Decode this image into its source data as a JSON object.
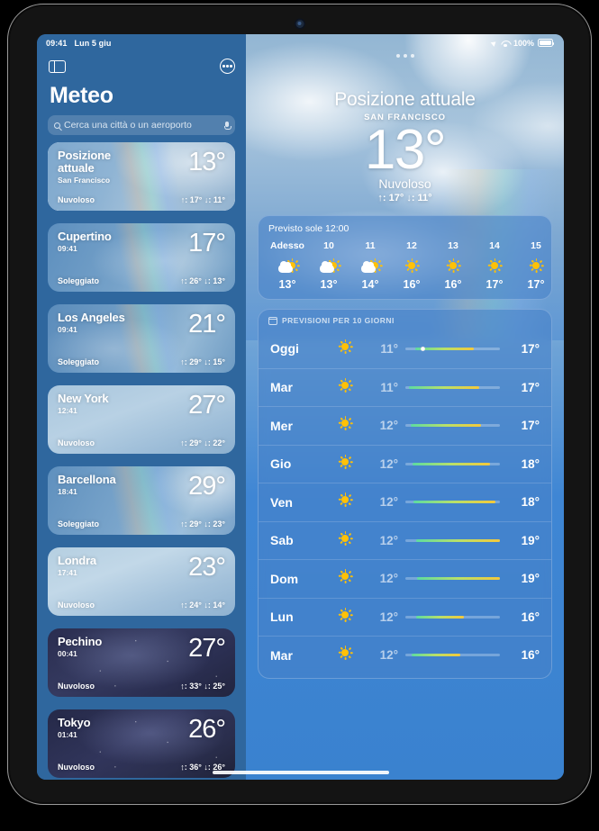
{
  "status_bar": {
    "time": "09:41",
    "date": "Lun 5 giu",
    "battery_percent": "100%",
    "location_icon": "location-arrow-icon",
    "wifi_icon": "wifi-icon",
    "battery_icon": "battery-icon"
  },
  "sidebar": {
    "toggle_icon": "sidebar-toggle-icon",
    "more_icon": "more-options-icon",
    "title": "Meteo",
    "search": {
      "placeholder": "Cerca una città o un aeroporto",
      "value": "",
      "search_icon": "search-icon",
      "mic_icon": "microphone-icon"
    },
    "cities": [
      {
        "name": "Posizione attuale",
        "sub": "San Francisco",
        "temp": "13°",
        "condition": "Nuvoloso",
        "hilo": "↑: 17°  ↓: 11°",
        "selected": true,
        "bg": "bg-sf"
      },
      {
        "name": "Cupertino",
        "sub": "09:41",
        "temp": "17°",
        "condition": "Soleggiato",
        "hilo": "↑: 26°  ↓: 13°",
        "selected": false,
        "bg": "bg-cup"
      },
      {
        "name": "Los Angeles",
        "sub": "09:41",
        "temp": "21°",
        "condition": "Soleggiato",
        "hilo": "↑: 29°  ↓: 15°",
        "selected": false,
        "bg": "bg-la"
      },
      {
        "name": "New York",
        "sub": "12:41",
        "temp": "27°",
        "condition": "Nuvoloso",
        "hilo": "↑: 29°  ↓: 22°",
        "selected": false,
        "bg": "bg-ny"
      },
      {
        "name": "Barcellona",
        "sub": "18:41",
        "temp": "29°",
        "condition": "Soleggiato",
        "hilo": "↑: 29°  ↓: 23°",
        "selected": false,
        "bg": "bg-barc"
      },
      {
        "name": "Londra",
        "sub": "17:41",
        "temp": "23°",
        "condition": "Nuvoloso",
        "hilo": "↑: 24°  ↓: 14°",
        "selected": false,
        "bg": "bg-lon"
      },
      {
        "name": "Pechino",
        "sub": "00:41",
        "temp": "27°",
        "condition": "Nuvoloso",
        "hilo": "↑: 33°  ↓: 25°",
        "selected": false,
        "bg": "bg-night"
      },
      {
        "name": "Tokyo",
        "sub": "01:41",
        "temp": "26°",
        "condition": "Nuvoloso",
        "hilo": "↑: 36°  ↓: 26°",
        "selected": false,
        "bg": "bg-tokyo"
      }
    ]
  },
  "main": {
    "hero": {
      "location": "Posizione attuale",
      "city": "SAN FRANCISCO",
      "temp": "13°",
      "condition": "Nuvoloso",
      "hilo": "↑: 17°  ↓: 11°"
    },
    "hourly": {
      "summary": "Previsto sole 12:00",
      "items": [
        {
          "hour": "Adesso",
          "icon": "sun-behind-cloud-icon",
          "temp": "13°"
        },
        {
          "hour": "10",
          "icon": "sun-behind-cloud-icon",
          "temp": "13°"
        },
        {
          "hour": "11",
          "icon": "sun-behind-cloud-icon",
          "temp": "14°"
        },
        {
          "hour": "12",
          "icon": "sun-icon",
          "temp": "16°"
        },
        {
          "hour": "13",
          "icon": "sun-icon",
          "temp": "16°"
        },
        {
          "hour": "14",
          "icon": "sun-icon",
          "temp": "17°"
        },
        {
          "hour": "15",
          "icon": "sun-icon",
          "temp": "17°"
        }
      ]
    },
    "daily": {
      "header": "PREVISIONI PER 10 GIORNI",
      "header_icon": "calendar-icon",
      "rows": [
        {
          "day": "Oggi",
          "icon": "sun-icon",
          "low": "11°",
          "high": "17°",
          "bar_start": 10,
          "bar_end": 72,
          "dot": 16
        },
        {
          "day": "Mar",
          "icon": "sun-icon",
          "low": "11°",
          "high": "17°",
          "bar_start": 4,
          "bar_end": 78,
          "dot": null
        },
        {
          "day": "Mer",
          "icon": "sun-icon",
          "low": "12°",
          "high": "17°",
          "bar_start": 6,
          "bar_end": 80,
          "dot": null
        },
        {
          "day": "Gio",
          "icon": "sun-icon",
          "low": "12°",
          "high": "18°",
          "bar_start": 8,
          "bar_end": 90,
          "dot": null
        },
        {
          "day": "Ven",
          "icon": "sun-icon",
          "low": "12°",
          "high": "18°",
          "bar_start": 9,
          "bar_end": 95,
          "dot": null
        },
        {
          "day": "Sab",
          "icon": "sun-icon",
          "low": "12°",
          "high": "19°",
          "bar_start": 11,
          "bar_end": 100,
          "dot": null
        },
        {
          "day": "Dom",
          "icon": "sun-icon",
          "low": "12°",
          "high": "19°",
          "bar_start": 12,
          "bar_end": 100,
          "dot": null
        },
        {
          "day": "Lun",
          "icon": "sun-icon",
          "low": "12°",
          "high": "16°",
          "bar_start": 11,
          "bar_end": 62,
          "dot": null
        },
        {
          "day": "Mar",
          "icon": "sun-icon",
          "low": "12°",
          "high": "16°",
          "bar_start": 7,
          "bar_end": 58,
          "dot": null
        }
      ]
    }
  },
  "colors": {
    "sidebar_bg": "#2f679e",
    "main_bg": "#3a82cf",
    "card_bg": "rgba(70,130,200,0.58)",
    "sun_yellow": "#FFC107",
    "bar_low": "#5ddba0",
    "bar_high": "#f5c93a"
  }
}
